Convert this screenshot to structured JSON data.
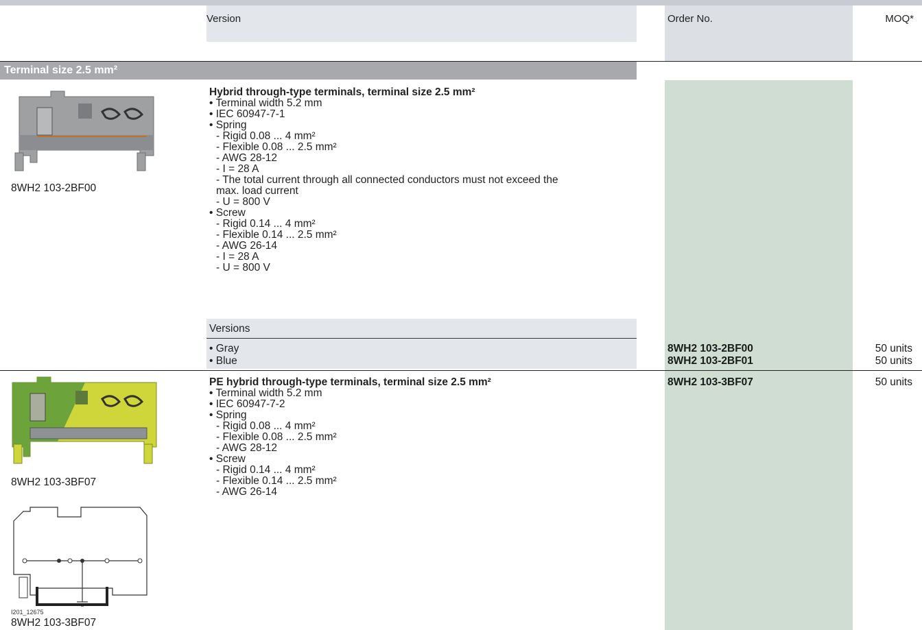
{
  "header": {
    "version": "Version",
    "order_no": "Order No.",
    "moq": "MOQ*"
  },
  "section": {
    "title": "Terminal size 2.5 mm²"
  },
  "product1": {
    "image_caption": "8WH2 103-2BF00",
    "title": "Hybrid through-type terminals, terminal size 2.5 mm²",
    "lines": [
      "• Terminal width 5.2 mm",
      "• IEC 60947-7-1",
      "• Spring",
      "  - Rigid 0.08 ... 4 mm²",
      "  - Flexible 0.08 ... 2.5 mm²",
      "  - AWG 28-12",
      "  - I = 28 A",
      "  - The total current through all connected conductors must not exceed the",
      "    max. load current",
      "  - U = 800 V",
      "• Screw",
      "  - Rigid 0.14 ... 4 mm²",
      "  - Flexible 0.14 ... 2.5 mm²",
      "  - AWG 26-14",
      "  - I = 28 A",
      "  - U = 800 V"
    ],
    "versions_label": "Versions",
    "versions": [
      {
        "name": "• Gray",
        "order_no": "8WH2 103-2BF00",
        "moq": "50 units"
      },
      {
        "name": "• Blue",
        "order_no": "8WH2 103-2BF01",
        "moq": "50 units"
      }
    ]
  },
  "product2": {
    "image_caption": "8WH2 103-3BF07",
    "diagram_id": "I201_12675",
    "diagram_caption": "8WH2 103-3BF07",
    "title": "PE hybrid through-type terminals, terminal size 2.5 mm²",
    "order_no": "8WH2 103-3BF07",
    "moq": "50 units",
    "lines": [
      "• Terminal width 5.2 mm",
      "• IEC 60947-7-2",
      "• Spring",
      "  - Rigid 0.08 ... 4 mm²",
      "  - Flexible 0.08 ... 2.5 mm²",
      "  - AWG 28-12",
      "• Screw",
      "  - Rigid 0.14 ... 4 mm²",
      "  - Flexible 0.14 ... 2.5 mm²",
      "  - AWG 26-14"
    ]
  },
  "colors": {
    "order_column": "#cfddd3",
    "section_bar": "#a7a9ac",
    "header_shade": "#dcdfe3"
  }
}
